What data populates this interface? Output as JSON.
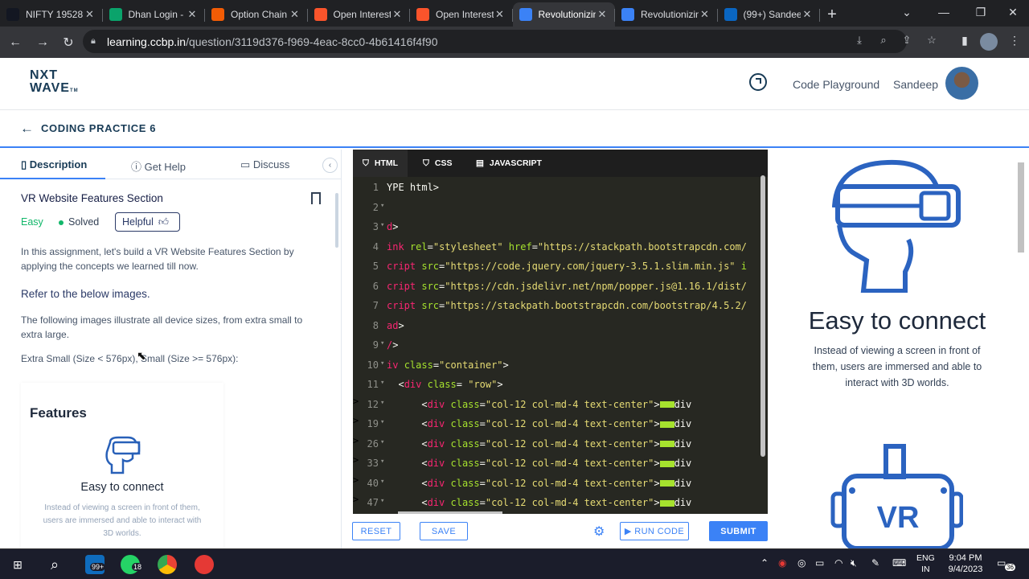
{
  "browser": {
    "tabs": [
      {
        "title": "NIFTY 19528",
        "icon": "tradingview-icon",
        "color": "#131722"
      },
      {
        "title": "Dhan Login -",
        "icon": "dhan-icon",
        "color": "#0aa36b"
      },
      {
        "title": "Option Chain",
        "icon": "option-chain-icon",
        "color": "#f25c05"
      },
      {
        "title": "Open Interest",
        "icon": "brave-icon",
        "color": "#fb542b"
      },
      {
        "title": "Open Interest",
        "icon": "brave-icon",
        "color": "#fb542b"
      },
      {
        "title": "Revolutionizin",
        "icon": "ccbp-icon",
        "color": "#3b82f6"
      },
      {
        "title": "Revolutionizin",
        "icon": "ccbp-icon",
        "color": "#3b82f6"
      },
      {
        "title": "(99+) Sandeep",
        "icon": "linkedin-icon",
        "color": "#0a66c2"
      }
    ],
    "url_host": "learning.ccbp.in",
    "url_path": "/question/3119d376-f969-4eac-8cc0-4b61416f4f90"
  },
  "app": {
    "logo_line1": "NXT",
    "logo_line2": "WAVE",
    "logo_tm": "TM",
    "code_playground": "Code Playground",
    "user_name": "Sandeep",
    "page_title": "CODING PRACTICE 6"
  },
  "left": {
    "tabs": [
      "Description",
      "Get Help",
      "Discuss"
    ],
    "question_title": "VR Website Features Section",
    "difficulty": "Easy",
    "status": "Solved",
    "helpful": "Helpful",
    "intro": "In this assignment, let's build a VR Website Features Section by applying the concepts we learned till now.",
    "refer": "Refer to the below images.",
    "following": "The following images illustrate all device sizes, from extra small to extra large.",
    "sizes": "Extra Small (Size < 576px), Small (Size >= 576px):",
    "preview": {
      "features": "Features",
      "heading": "Easy to connect",
      "desc": "Instead of viewing a screen in front of them, users are immersed and able to interact with 3D worlds."
    }
  },
  "editor": {
    "tabs": [
      "HTML",
      "CSS",
      "JAVASCRIPT"
    ],
    "lines": [
      {
        "n": "1",
        "fold": false,
        "html": "<span>YPE html></span>"
      },
      {
        "n": "2",
        "fold": true,
        "html": ""
      },
      {
        "n": "3",
        "fold": true,
        "html": "<span class=\"t\">d</span>>"
      },
      {
        "n": "4",
        "fold": false,
        "html": "<span class=\"t\">ink</span> <span class=\"a\">rel</span>=<span class=\"s\">\"stylesheet\"</span> <span class=\"a\">href</span>=<span class=\"s\">\"https://stackpath.bootstrapcdn.com/</span>"
      },
      {
        "n": "5",
        "fold": false,
        "html": "<span class=\"t\">cript</span> <span class=\"a\">src</span>=<span class=\"s\">\"https://code.jquery.com/jquery-3.5.1.slim.min.js\"</span> <span class=\"a\">i</span>"
      },
      {
        "n": "6",
        "fold": false,
        "html": "<span class=\"t\">cript</span> <span class=\"a\">src</span>=<span class=\"s\">\"https://cdn.jsdelivr.net/npm/popper.js@1.16.1/dist/</span>"
      },
      {
        "n": "7",
        "fold": false,
        "html": "<span class=\"t\">cript</span> <span class=\"a\">src</span>=<span class=\"s\">\"https://stackpath.bootstrapcdn.com/bootstrap/4.5.2/</span>"
      },
      {
        "n": "8",
        "fold": false,
        "html": "<span class=\"t\">ad</span>>"
      },
      {
        "n": "9",
        "fold": true,
        "html": "<span class=\"t\">/</span>>"
      },
      {
        "n": "10",
        "fold": true,
        "html": "<span class=\"t\">iv</span> <span class=\"a\">class</span>=<span class=\"s\">\"container\"</span>>"
      },
      {
        "n": "11",
        "fold": true,
        "html": "  <<span class=\"t\">div</span> <span class=\"a\">class</span>= <span class=\"s\">\"row\"</span>>"
      },
      {
        "n": "12",
        "fold": true,
        "html": "      <<span class=\"t\">div</span> <span class=\"a\">class</span>=<span class=\"s\">\"col-12 col-md-4 text-center\"</span>><i class=\"fl\"></i></<span class=\"t\">div</span>>"
      },
      {
        "n": "19",
        "fold": true,
        "html": "      <<span class=\"t\">div</span> <span class=\"a\">class</span>=<span class=\"s\">\"col-12 col-md-4 text-center\"</span>><i class=\"fl\"></i></<span class=\"t\">div</span>>"
      },
      {
        "n": "26",
        "fold": true,
        "html": "      <<span class=\"t\">div</span> <span class=\"a\">class</span>=<span class=\"s\">\"col-12 col-md-4 text-center\"</span>><i class=\"fl\"></i></<span class=\"t\">div</span>>"
      },
      {
        "n": "33",
        "fold": true,
        "html": "      <<span class=\"t\">div</span> <span class=\"a\">class</span>=<span class=\"s\">\"col-12 col-md-4 text-center\"</span>><i class=\"fl\"></i></<span class=\"t\">div</span>>"
      },
      {
        "n": "40",
        "fold": true,
        "html": "      <<span class=\"t\">div</span> <span class=\"a\">class</span>=<span class=\"s\">\"col-12 col-md-4 text-center\"</span>><i class=\"fl\"></i></<span class=\"t\">div</span>>"
      },
      {
        "n": "47",
        "fold": true,
        "html": "      <<span class=\"t\">div</span> <span class=\"a\">class</span>=<span class=\"s\">\"col-12 col-md-4 text-center\"</span>><i class=\"fl\"></i></<span class=\"t\">div</span>>"
      }
    ],
    "reset": "RESET",
    "save": "SAVE",
    "run": "▶ RUN CODE",
    "submit": "SUBMIT"
  },
  "output": {
    "heading": "Easy to connect",
    "desc": "Instead of viewing a screen in front of them, users are immersed and able to interact with 3D worlds.",
    "vr_text": "VR"
  },
  "taskbar": {
    "mail_badge": "99+",
    "whatsapp_badge": "18",
    "lang1": "ENG",
    "lang2": "IN",
    "time": "9:04 PM",
    "date": "9/4/2023",
    "notif": "36"
  },
  "colors": {
    "accent": "#3b82f6",
    "brand": "#183b56",
    "easy": "#12b76a"
  }
}
